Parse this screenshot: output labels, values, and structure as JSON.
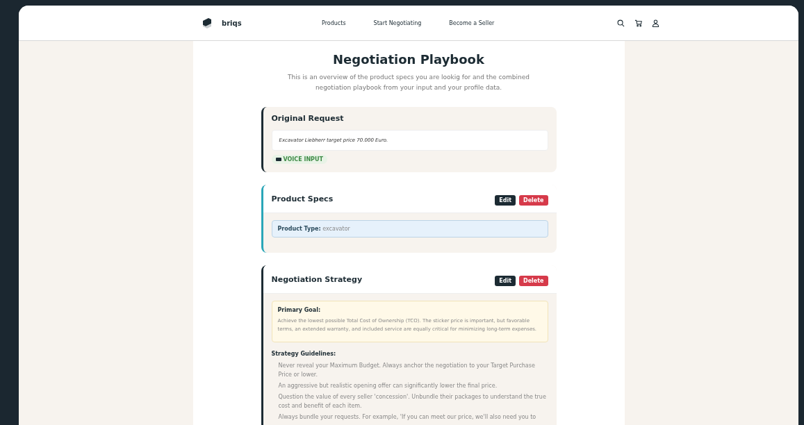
{
  "brand": "briqs",
  "nav": [
    "Products",
    "Start Negotiating",
    "Become a Seller"
  ],
  "page": {
    "title": "Negotiation Playbook",
    "subtitle": "This is an overview of the product specs you are lookig for and the combined negotiation playbook from your input and your profile data."
  },
  "original_request": {
    "title": "Original Request",
    "text": "Excavator Liebherr target price 70.000 Euro.",
    "badge": "VOICE INPUT"
  },
  "sections": [
    {
      "kind": "specs",
      "title": "Product Specs",
      "actions": [
        "Edit",
        "Delete"
      ],
      "spec_label": "Product Type:",
      "spec_value": "excavator"
    },
    {
      "kind": "strategy",
      "title": "Negotiation Strategy",
      "actions": [
        "Edit",
        "Delete"
      ],
      "goal_title": "Primary Goal:",
      "goal_text": "Achieve the lowest possible Total Cost of Ownership (TCO). The sticker price is important, but favorable terms, an extended warranty, and included service are equally critical for minimizing long-term expenses.",
      "guidelines_title": "Strategy Guidelines:",
      "guidelines": [
        "Never reveal your Maximum Budget. Always anchor the negotiation to your Target Purchase Price or lower.",
        "An aggressive but realistic opening offer can significantly lower the final price.",
        "Question the value of every seller 'concession'. Unbundle their packages to understand the true cost and benefit of each item.",
        "Always bundle your requests. For example, 'If you can meet our price, we'll also need you to"
      ]
    }
  ]
}
